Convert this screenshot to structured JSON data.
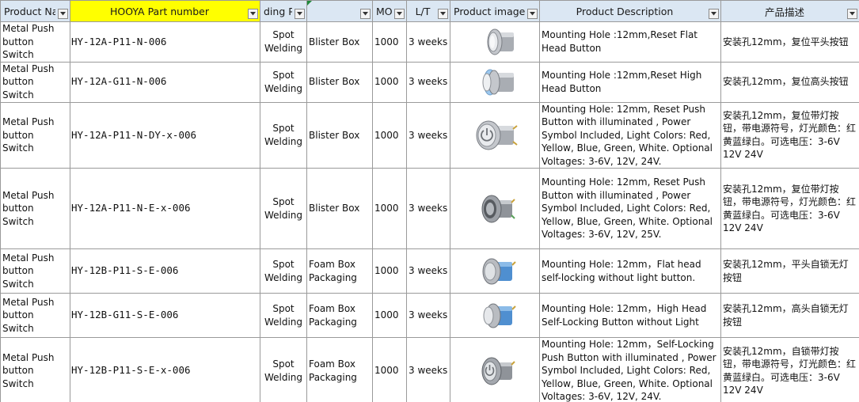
{
  "headers": {
    "product_name": "Product Nar",
    "part_number": "HOOYA Part number",
    "welding_process": "ding Pro",
    "packaging": "",
    "moq": "MO",
    "lead_time": "L/T",
    "product_image": "Product image",
    "product_description": "Product Description",
    "chinese_description": "产品描述"
  },
  "colors": {
    "header_bg": "#dbe7f3",
    "header_highlight": "#ffff00",
    "grid_line": "#9a9a9a",
    "comment_marker": "#1f8a3b"
  },
  "rows": [
    {
      "name": "Metal Push button Switch",
      "part": "HY-12A-P11-N-006",
      "welding": "Spot Welding",
      "packaging": "Blister Box",
      "moq": "1000",
      "lead_time": "3 weeks",
      "image_icon": "flat-head-button-photo",
      "description": "Mounting Hole :12mm,Reset Flat Head Button",
      "cn": "安装孔12mm，复位平头按钮"
    },
    {
      "name": "Metal Push button Switch",
      "part": "HY-12A-G11-N-006",
      "welding": "Spot Welding",
      "packaging": "Blister Box",
      "moq": "1000",
      "lead_time": "3 weeks",
      "image_icon": "high-head-button-photo",
      "description": "Mounting Hole :12mm,Reset High Head Button",
      "cn": "安装孔12mm，复位高头按钮"
    },
    {
      "name": "Metal Push button Switch",
      "part": "HY-12A-P11-N-DY-x-006",
      "welding": "Spot Welding",
      "packaging": "Blister Box",
      "moq": "1000",
      "lead_time": "3 weeks",
      "image_icon": "power-symbol-button-photo",
      "description": "Mounting Hole: 12mm, Reset Push Button with illuminated , Power Symbol Included, Light Colors: Red, Yellow, Blue, Green, White. Optional Voltages: 3-6V, 12V, 24V.",
      "cn": "安装孔12mm，复位带灯按钮，带电源符号，灯光颜色：红黄蓝绿白。可选电压：3-6V 12V 24V"
    },
    {
      "name": "Metal Push button Switch",
      "part": "HY-12A-P11-N-E-x-006",
      "welding": "Spot Welding",
      "packaging": "Blister Box",
      "moq": "1000",
      "lead_time": "3 weeks",
      "image_icon": "ring-illuminated-button-photo",
      "description": "Mounting Hole: 12mm, Reset Push Button with illuminated , Power Symbol Included, Light Colors: Red, Yellow, Blue, Green, White. Optional Voltages: 3-6V, 12V, 25V.",
      "cn": "安装孔12mm，复位带灯按钮，带电源符号，灯光颜色：红黄蓝绿白。可选电压：3-6V 12V 24V"
    },
    {
      "name": "Metal Push button Switch",
      "part": "HY-12B-P11-S-E-006",
      "welding": "Spot Welding",
      "packaging": "Foam Box Packaging",
      "moq": "1000",
      "lead_time": "3 weeks",
      "image_icon": "self-locking-flat-button-photo",
      "description": "Mounting Hole: 12mm，Flat head self-locking without light button.",
      "cn": "安装孔12mm，平头自锁无灯按钮"
    },
    {
      "name": "Metal Push button Switch",
      "part": "HY-12B-G11-S-E-006",
      "welding": "Spot Welding",
      "packaging": "Foam Box Packaging",
      "moq": "1000",
      "lead_time": "3 weeks",
      "image_icon": "self-locking-high-button-photo",
      "description": "Mounting Hole: 12mm，High Head Self-Locking Button without Light",
      "cn": "安装孔12mm，高头自锁无灯按钮"
    },
    {
      "name": "Metal Push button Switch",
      "part": "HY-12B-P11-S-E-x-006",
      "welding": "Spot Welding",
      "packaging": "Foam Box Packaging",
      "moq": "1000",
      "lead_time": "3 weeks",
      "image_icon": "self-locking-illuminated-button-photo",
      "description": "Mounting Hole: 12mm，Self-Locking Push Button with illuminated , Power Symbol Included, Light Colors: Red, Yellow, Blue, Green, White. Optional Voltages: 3-6V, 12V, 24V.",
      "cn": "安装孔12mm，自锁带灯按钮，带电源符号，灯光颜色：红黄蓝绿白。可选电压：3-6V 12V 24V"
    }
  ]
}
